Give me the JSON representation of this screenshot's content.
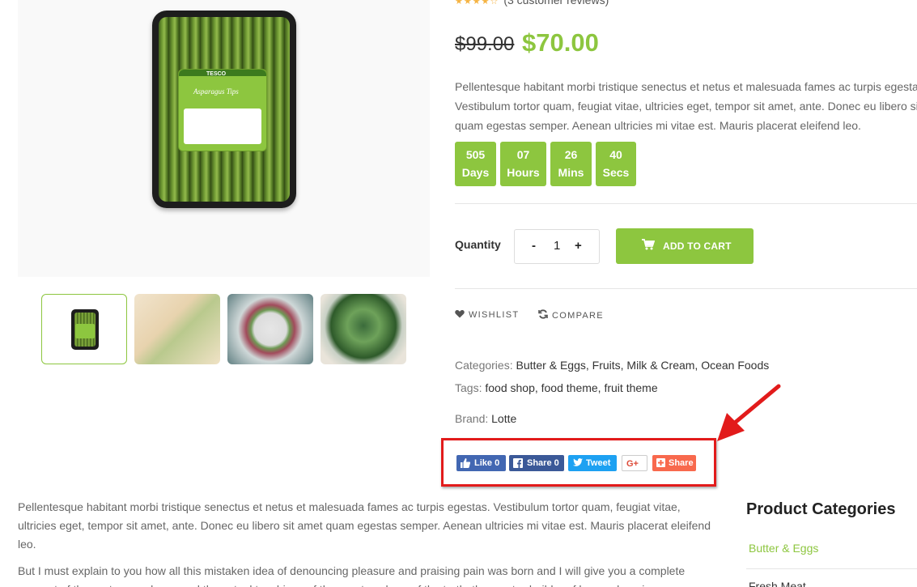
{
  "product": {
    "rating_text": "(3 customer reviews)",
    "rating_value": 4,
    "old_price": "$99.00",
    "new_price": "$70.00",
    "description_lines": [
      "Pellentesque habitant morbi tristique senectus et netus et malesuada fames ac turpis egestas.",
      "Vestibulum tortor quam, feugiat vitae, ultricies eget, tempor sit amet, ante. Donec eu libero sit amet",
      "quam egestas semper. Aenean ultricies mi vitae est. Mauris placerat eleifend leo."
    ],
    "package_label": "Asparagus Tips",
    "package_brand": "TESCO"
  },
  "countdown": [
    {
      "value": "505",
      "unit": "Days"
    },
    {
      "value": "07",
      "unit": "Hours"
    },
    {
      "value": "26",
      "unit": "Mins"
    },
    {
      "value": "40",
      "unit": "Secs"
    }
  ],
  "quantity": {
    "label": "Quantity",
    "minus": "-",
    "value": "1",
    "plus": "+"
  },
  "add_to_cart": {
    "label": "ADD TO CART",
    "icon": "cart-icon"
  },
  "actions": {
    "wishlist": {
      "label": "WISHLIST",
      "icon": "heart-icon"
    },
    "compare": {
      "label": "COMPARE",
      "icon": "refresh-icon"
    }
  },
  "meta": {
    "categories_label": "Categories:",
    "categories_value": "Butter & Eggs, Fruits, Milk & Cream, Ocean Foods",
    "tags_label": "Tags:",
    "tags_value": "food shop, food theme, fruit theme",
    "brand_label": "Brand:",
    "brand_value": "Lotte"
  },
  "share_buttons": {
    "fb_like": "Like 0",
    "fb_share": "Share 0",
    "tweet": "Tweet",
    "gplus": "G+",
    "addthis": "Share"
  },
  "body": {
    "paragraph1": "Pellentesque habitant morbi tristique senectus et netus et malesuada fames ac turpis egestas. Vestibulum tortor quam, feugiat vitae, ultricies eget, tempor sit amet, ante. Donec eu libero sit amet quam egestas semper. Aenean ultricies mi vitae est. Mauris placerat eleifend leo.",
    "paragraph2": "But I must explain to you how all this mistaken idea of denouncing pleasure and praising pain was born and I will give you a complete account of the system, and expound the actual teachings of the great explorer of the truth, the master-builder of human happiness."
  },
  "sidebar": {
    "title": "Product Categories",
    "items": [
      "Butter & Eggs",
      "Fresh Meat"
    ]
  },
  "colors": {
    "accent": "#8dc63f",
    "highlight": "#e21b1b",
    "facebook": "#4267b2",
    "twitter": "#1da1f2",
    "addthis": "#f8694d"
  }
}
